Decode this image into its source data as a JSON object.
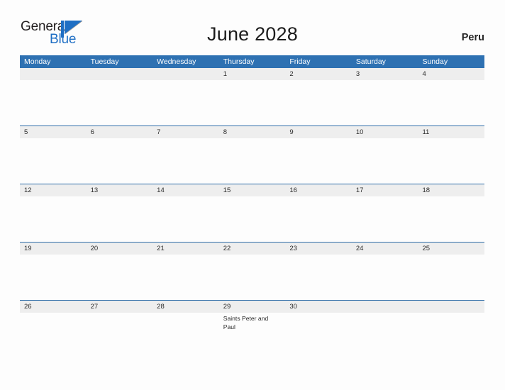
{
  "brand": {
    "name_part1": "General",
    "name_part2": "Blue",
    "flag_icon": "triangle-flag-icon",
    "colors": {
      "text_dark": "#231f20",
      "blue": "#1f6fc4"
    }
  },
  "header": {
    "title": "June 2028",
    "country": "Peru"
  },
  "colors": {
    "header_blue": "#2e71b2",
    "row_band_gray": "#eeeeee",
    "row_rule_blue": "#2e6da8",
    "page_background": "#fdfdfd",
    "day_text": "#2b2b2b"
  },
  "calendar": {
    "weekdays": [
      "Monday",
      "Tuesday",
      "Wednesday",
      "Thursday",
      "Friday",
      "Saturday",
      "Sunday"
    ],
    "weeks": [
      {
        "days": [
          {
            "number": "",
            "event": ""
          },
          {
            "number": "",
            "event": ""
          },
          {
            "number": "",
            "event": ""
          },
          {
            "number": "1",
            "event": ""
          },
          {
            "number": "2",
            "event": ""
          },
          {
            "number": "3",
            "event": ""
          },
          {
            "number": "4",
            "event": ""
          }
        ]
      },
      {
        "days": [
          {
            "number": "5",
            "event": ""
          },
          {
            "number": "6",
            "event": ""
          },
          {
            "number": "7",
            "event": ""
          },
          {
            "number": "8",
            "event": ""
          },
          {
            "number": "9",
            "event": ""
          },
          {
            "number": "10",
            "event": ""
          },
          {
            "number": "11",
            "event": ""
          }
        ]
      },
      {
        "days": [
          {
            "number": "12",
            "event": ""
          },
          {
            "number": "13",
            "event": ""
          },
          {
            "number": "14",
            "event": ""
          },
          {
            "number": "15",
            "event": ""
          },
          {
            "number": "16",
            "event": ""
          },
          {
            "number": "17",
            "event": ""
          },
          {
            "number": "18",
            "event": ""
          }
        ]
      },
      {
        "days": [
          {
            "number": "19",
            "event": ""
          },
          {
            "number": "20",
            "event": ""
          },
          {
            "number": "21",
            "event": ""
          },
          {
            "number": "22",
            "event": ""
          },
          {
            "number": "23",
            "event": ""
          },
          {
            "number": "24",
            "event": ""
          },
          {
            "number": "25",
            "event": ""
          }
        ]
      },
      {
        "days": [
          {
            "number": "26",
            "event": ""
          },
          {
            "number": "27",
            "event": ""
          },
          {
            "number": "28",
            "event": ""
          },
          {
            "number": "29",
            "event": "Saints Peter and Paul"
          },
          {
            "number": "30",
            "event": ""
          },
          {
            "number": "",
            "event": ""
          },
          {
            "number": "",
            "event": ""
          }
        ]
      }
    ]
  }
}
